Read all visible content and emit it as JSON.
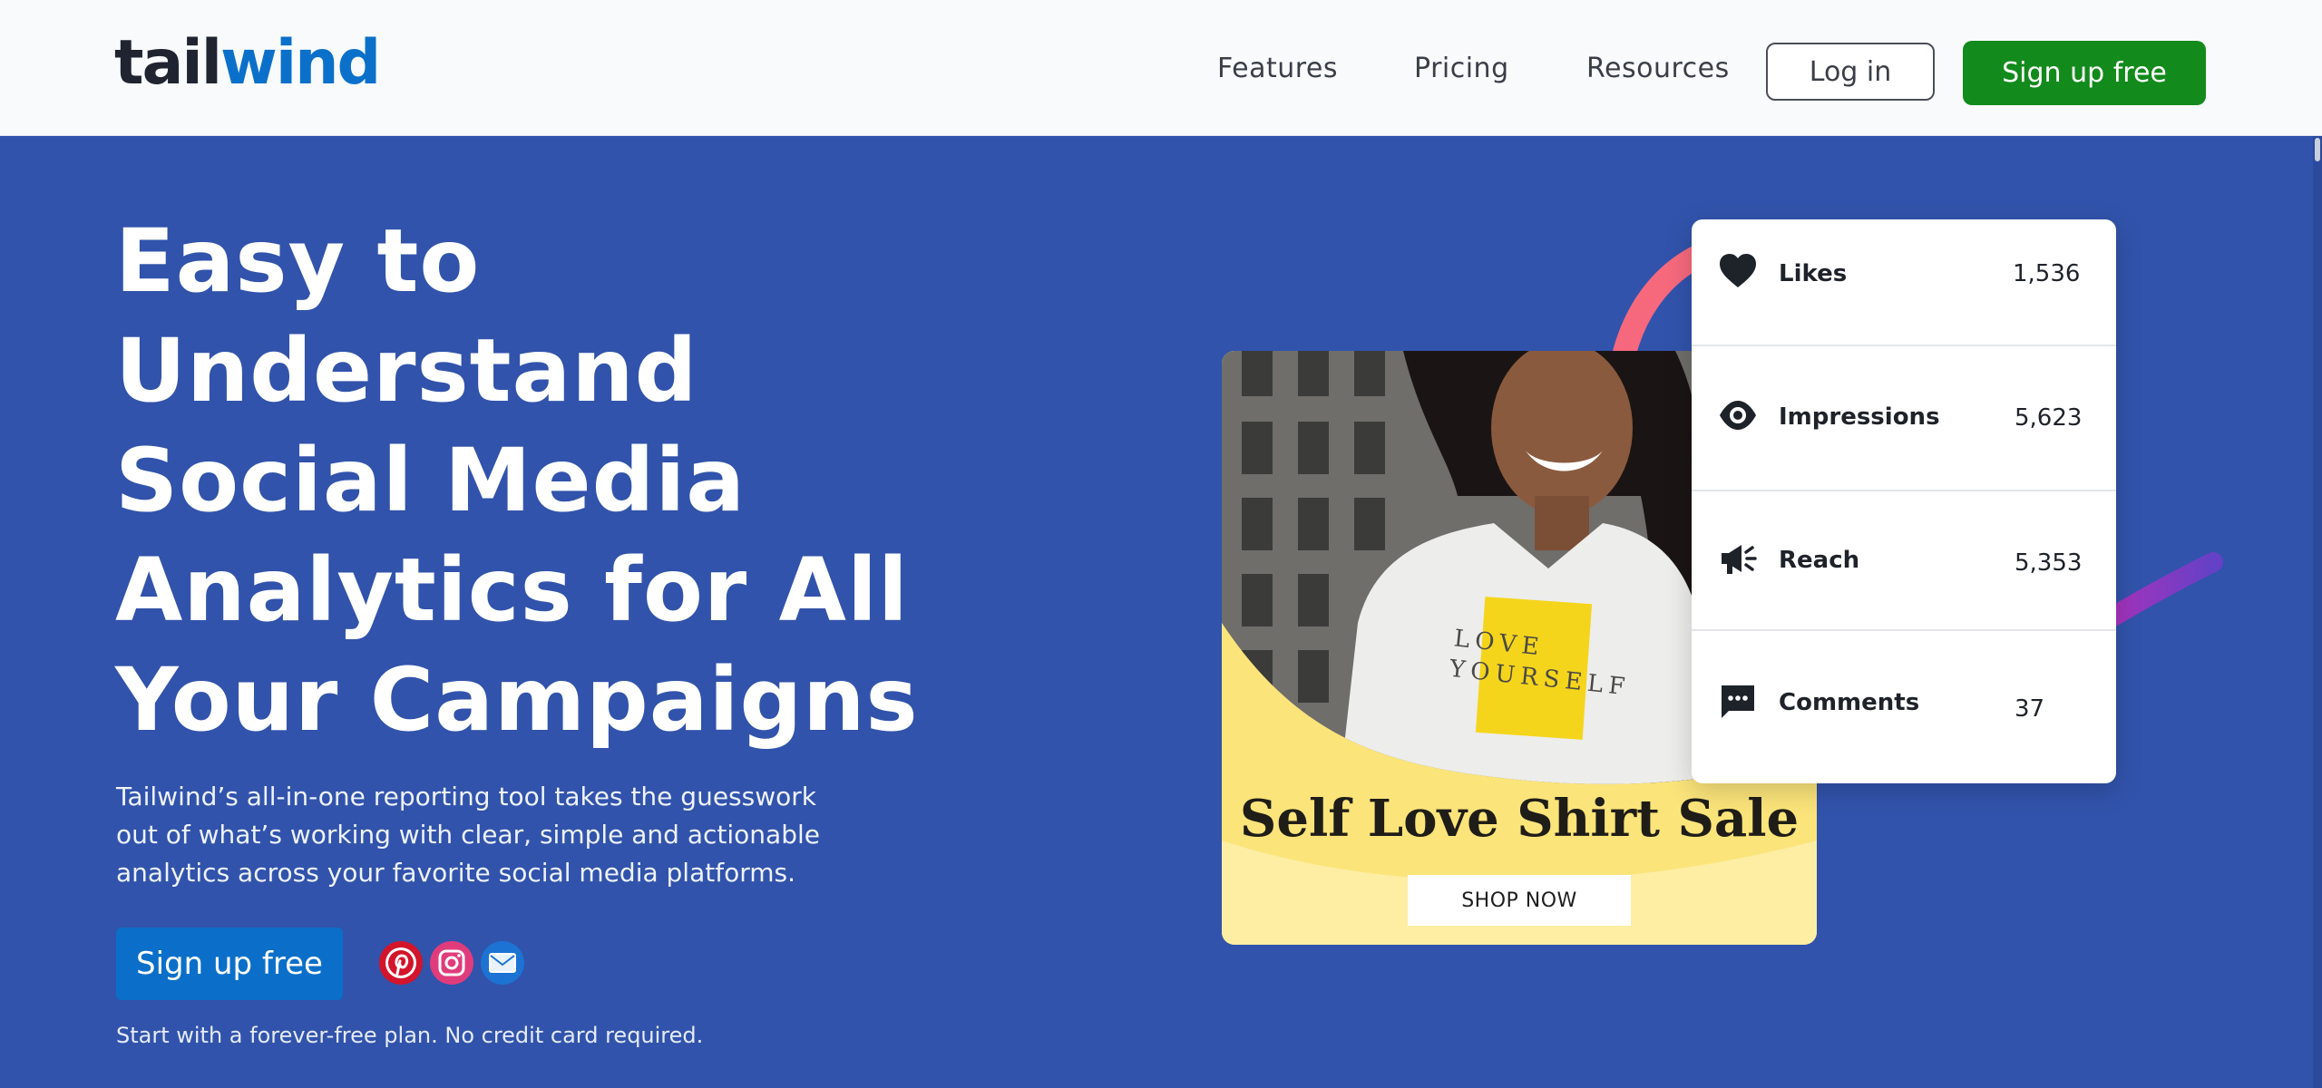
{
  "header": {
    "logo_part1": "tail",
    "logo_part2": "wind",
    "nav": [
      "Features",
      "Pricing",
      "Resources"
    ],
    "login_label": "Log in",
    "signup_label": "Sign up free"
  },
  "hero": {
    "title_lines": [
      "Easy to",
      "Understand",
      "Social Media",
      "Analytics for All",
      "Your Campaigns"
    ],
    "subtitle_lines": [
      "Tailwind’s all-in-one reporting tool takes the guesswork",
      "out of what’s working with clear, simple and actionable",
      "analytics across your favorite social media platforms."
    ],
    "cta_label": "Sign up free",
    "note": "Start with a forever-free plan. No credit card required.",
    "social_icons": [
      "pinterest-icon",
      "instagram-icon",
      "email-icon"
    ]
  },
  "promo": {
    "shirt_text_1": "LOVE",
    "shirt_text_2": "YOURSELF",
    "heading": "Self Love Shirt Sale",
    "button": "SHOP NOW"
  },
  "stats": [
    {
      "icon": "heart-icon",
      "label": "Likes",
      "value": "1,536"
    },
    {
      "icon": "eye-icon",
      "label": "Impressions",
      "value": "5,623"
    },
    {
      "icon": "megaphone-icon",
      "label": "Reach",
      "value": "5,353"
    },
    {
      "icon": "comment-icon",
      "label": "Comments",
      "value": "37"
    }
  ],
  "colors": {
    "hero_bg": "#3153ab",
    "brand_blue": "#0b70c9",
    "signup_green": "#138a1c",
    "promo_yellow": "#fbe47a"
  }
}
